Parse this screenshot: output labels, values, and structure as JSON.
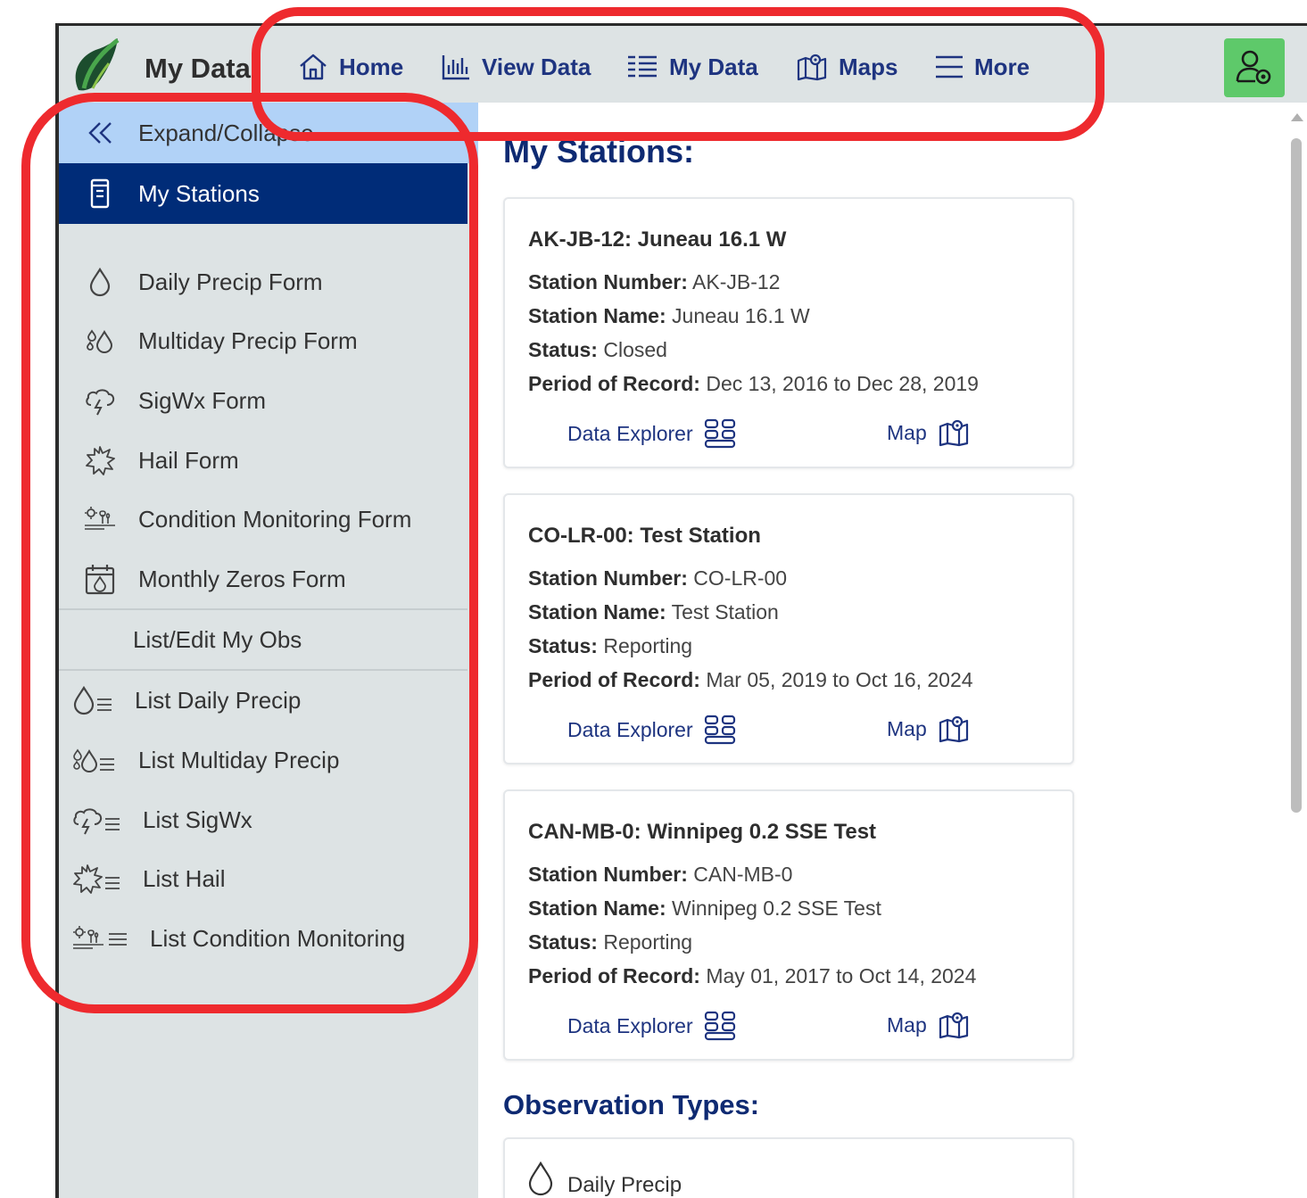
{
  "app": {
    "brand": "My Data"
  },
  "nav": {
    "items": [
      {
        "label": "Home",
        "icon": "home-icon"
      },
      {
        "label": "View Data",
        "icon": "bar-chart-icon"
      },
      {
        "label": "My Data",
        "icon": "list-icon"
      },
      {
        "label": "Maps",
        "icon": "map-icon"
      },
      {
        "label": "More",
        "icon": "menu-icon"
      }
    ],
    "user_icon": "user-settings-icon"
  },
  "sidebar": {
    "expand_label": "Expand/Collapse",
    "items": [
      {
        "label": "My Stations",
        "icon": "station-icon",
        "active": true
      },
      {
        "label": "Daily Precip Form",
        "icon": "drop-icon"
      },
      {
        "label": "Multiday Precip Form",
        "icon": "multi-drop-icon"
      },
      {
        "label": "SigWx Form",
        "icon": "storm-icon"
      },
      {
        "label": "Hail Form",
        "icon": "hail-icon"
      },
      {
        "label": "Condition Monitoring Form",
        "icon": "condition-icon"
      },
      {
        "label": "Monthly Zeros Form",
        "icon": "calendar-icon"
      }
    ],
    "section_label": "List/Edit My Obs",
    "list_items": [
      {
        "label": "List Daily Precip",
        "icon": "drop-list-icon"
      },
      {
        "label": "List Multiday Precip",
        "icon": "multi-drop-list-icon"
      },
      {
        "label": "List SigWx",
        "icon": "storm-list-icon"
      },
      {
        "label": "List Hail",
        "icon": "hail-list-icon"
      },
      {
        "label": "List Condition Monitoring",
        "icon": "condition-list-icon"
      }
    ]
  },
  "main": {
    "stations_title": "My Stations:",
    "field_labels": {
      "number": "Station Number:",
      "name": "Station Name:",
      "status": "Status:",
      "period": "Period of Record:"
    },
    "link_labels": {
      "explorer": "Data Explorer",
      "map": "Map"
    },
    "stations": [
      {
        "title": "AK-JB-12: Juneau 16.1 W",
        "number": "AK-JB-12",
        "name": "Juneau 16.1 W",
        "status": "Closed",
        "period": "Dec 13, 2016 to Dec 28, 2019"
      },
      {
        "title": "CO-LR-00: Test Station",
        "number": "CO-LR-00",
        "name": "Test Station",
        "status": "Reporting",
        "period": "Mar 05, 2019 to Oct 16, 2024"
      },
      {
        "title": "CAN-MB-0: Winnipeg 0.2 SSE Test",
        "number": "CAN-MB-0",
        "name": "Winnipeg 0.2 SSE Test",
        "status": "Reporting",
        "period": "May 01, 2017 to Oct 14, 2024"
      }
    ],
    "obs_title": "Observation Types:",
    "obs_types": [
      {
        "label": "Daily Precip",
        "icon": "drop-icon"
      }
    ]
  },
  "colors": {
    "navy": "#0e2a72",
    "active_bg": "#002c78",
    "highlight_bg": "#b1d2f7",
    "bar_bg": "#dde3e4",
    "user_btn": "#5ec96a",
    "annotation": "#ee2a2e"
  }
}
